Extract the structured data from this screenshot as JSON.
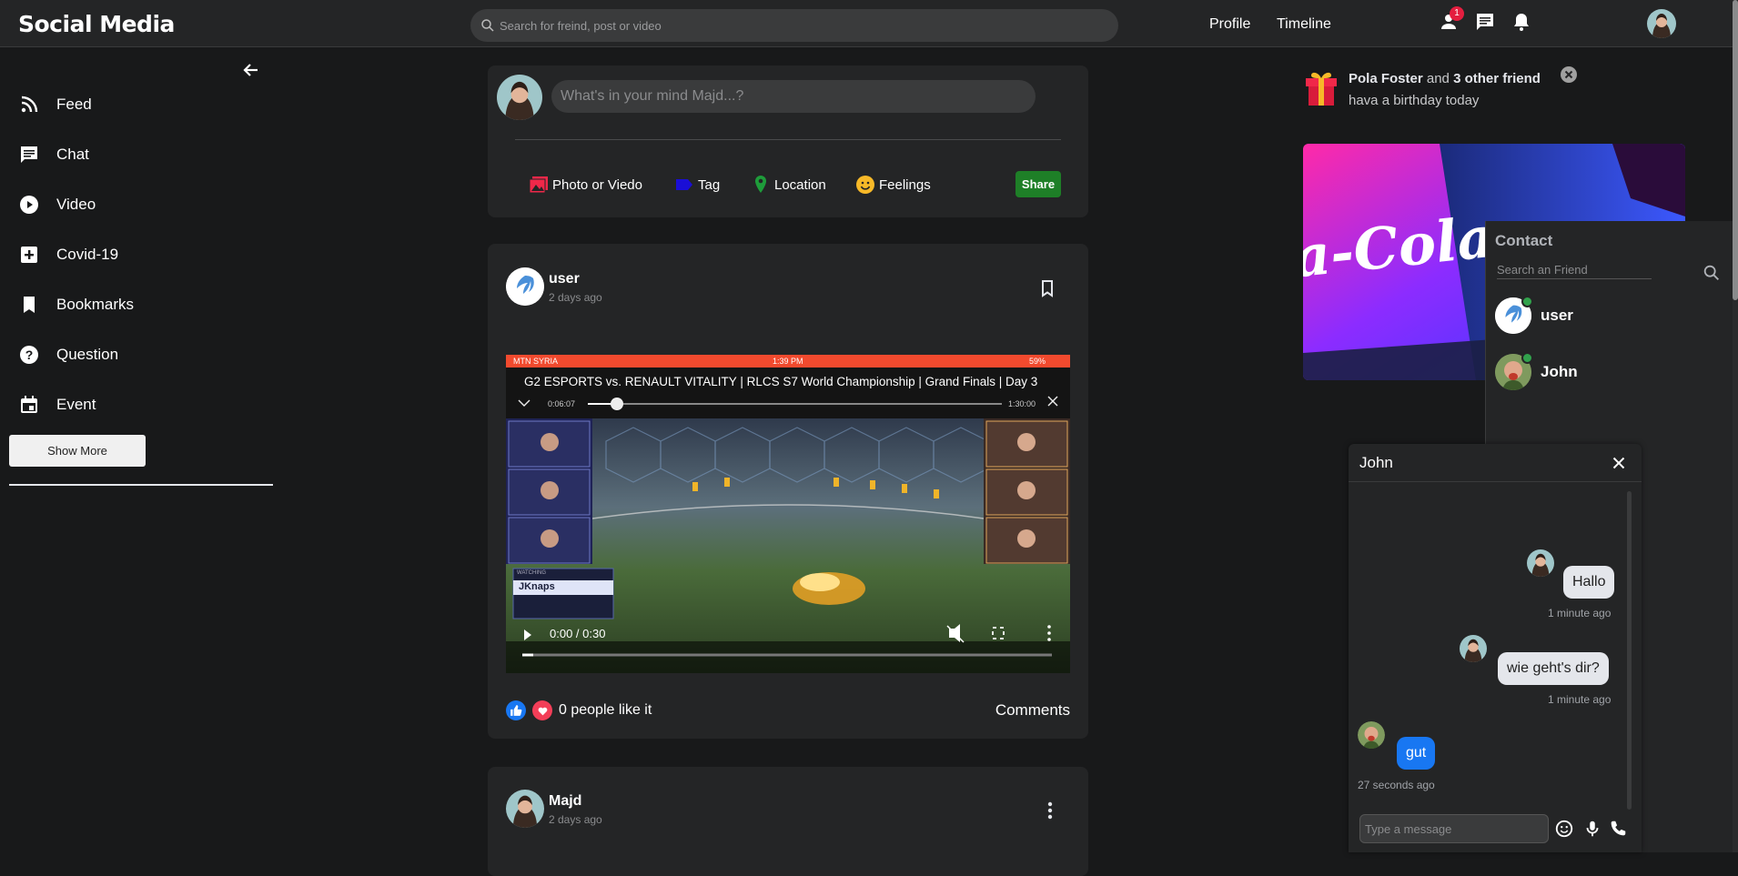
{
  "app": {
    "title": "Social Media"
  },
  "search": {
    "placeholder": "Search for freind, post or video"
  },
  "header": {
    "links": [
      "Profile",
      "Timeline"
    ],
    "friend_request_badge": "1",
    "icons": [
      "person-icon",
      "message-icon",
      "bell-icon"
    ]
  },
  "sidebar": {
    "items": [
      {
        "label": "Feed",
        "icon": "rss-icon"
      },
      {
        "label": "Chat",
        "icon": "chat-icon"
      },
      {
        "label": "Video",
        "icon": "play-circle-icon"
      },
      {
        "label": "Covid-19",
        "icon": "medical-plus-icon"
      },
      {
        "label": "Bookmarks",
        "icon": "bookmark-icon"
      },
      {
        "label": "Question",
        "icon": "help-circle-icon"
      },
      {
        "label": "Event",
        "icon": "calendar-icon"
      }
    ],
    "show_more": "Show More"
  },
  "share": {
    "placeholder": "What's in your mind Majd...?",
    "options": [
      "Photo or Viedo",
      "Tag",
      "Location",
      "Feelings"
    ],
    "share_label": "Share"
  },
  "post": {
    "author": "user",
    "time": "2 days ago",
    "video": {
      "title": "G2 ESPORTS vs. RENAULT VITALITY | RLCS S7 World Championship | Grand Finals | Day 3",
      "status_carrier": "MTN SYRIA",
      "status_clock": "1:39 PM",
      "status_battery": "59%",
      "inner_elapsed": "0:06:07",
      "inner_total": "1:30:00",
      "player_time": "0:00 / 0:30",
      "player_name": "JKnaps",
      "watching_label": "WATCHING",
      "played_fraction": 0.02
    },
    "likes": "0 people like it",
    "comments": "Comments"
  },
  "post2": {
    "author": "Majd",
    "time": "2 days ago"
  },
  "birthday": {
    "name": "Pola Foster",
    "and": "and",
    "others": "3 other friend",
    "text": "hava a birthday today"
  },
  "contacts": {
    "title": "Contact",
    "search_placeholder": "Search an Friend",
    "list": [
      {
        "name": "user",
        "online": true
      },
      {
        "name": "John",
        "online": true
      }
    ]
  },
  "chat": {
    "title": "John",
    "messages": [
      {
        "text": "Hallo",
        "time": "1 minute ago",
        "from": "me"
      },
      {
        "text": "wie geht's dir?",
        "time": "1 minute ago",
        "from": "me"
      },
      {
        "text": "gut",
        "time": "27 seconds ago",
        "from": "them"
      }
    ],
    "input_placeholder": "Type a message"
  },
  "colors": {
    "background": "#18191a",
    "card": "#242526",
    "accent_green": "#1e7f27",
    "online": "#31a24c",
    "them_bubble": "#1877f2",
    "like_blue": "#1877f2",
    "heart_red": "#f33e58"
  }
}
